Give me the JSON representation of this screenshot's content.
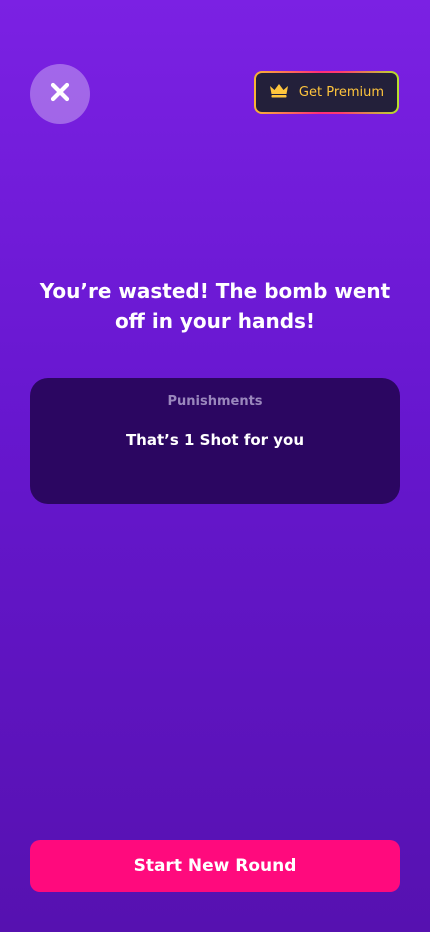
{
  "header": {
    "close_icon": "close-icon",
    "premium_label": "Get Premium",
    "premium_icon": "crown-icon"
  },
  "result": {
    "message": "You’re wasted! The bomb went off in your hands!"
  },
  "punishment_card": {
    "title": "Punishments",
    "text": "That’s 1 Shot for you"
  },
  "footer": {
    "start_label": "Start New Round"
  },
  "colors": {
    "background_top": "#7b21e3",
    "background_bottom": "#5611b0",
    "card": "#2b0661",
    "primary_button": "#ff0a7d",
    "premium_text": "#ffc53d"
  }
}
